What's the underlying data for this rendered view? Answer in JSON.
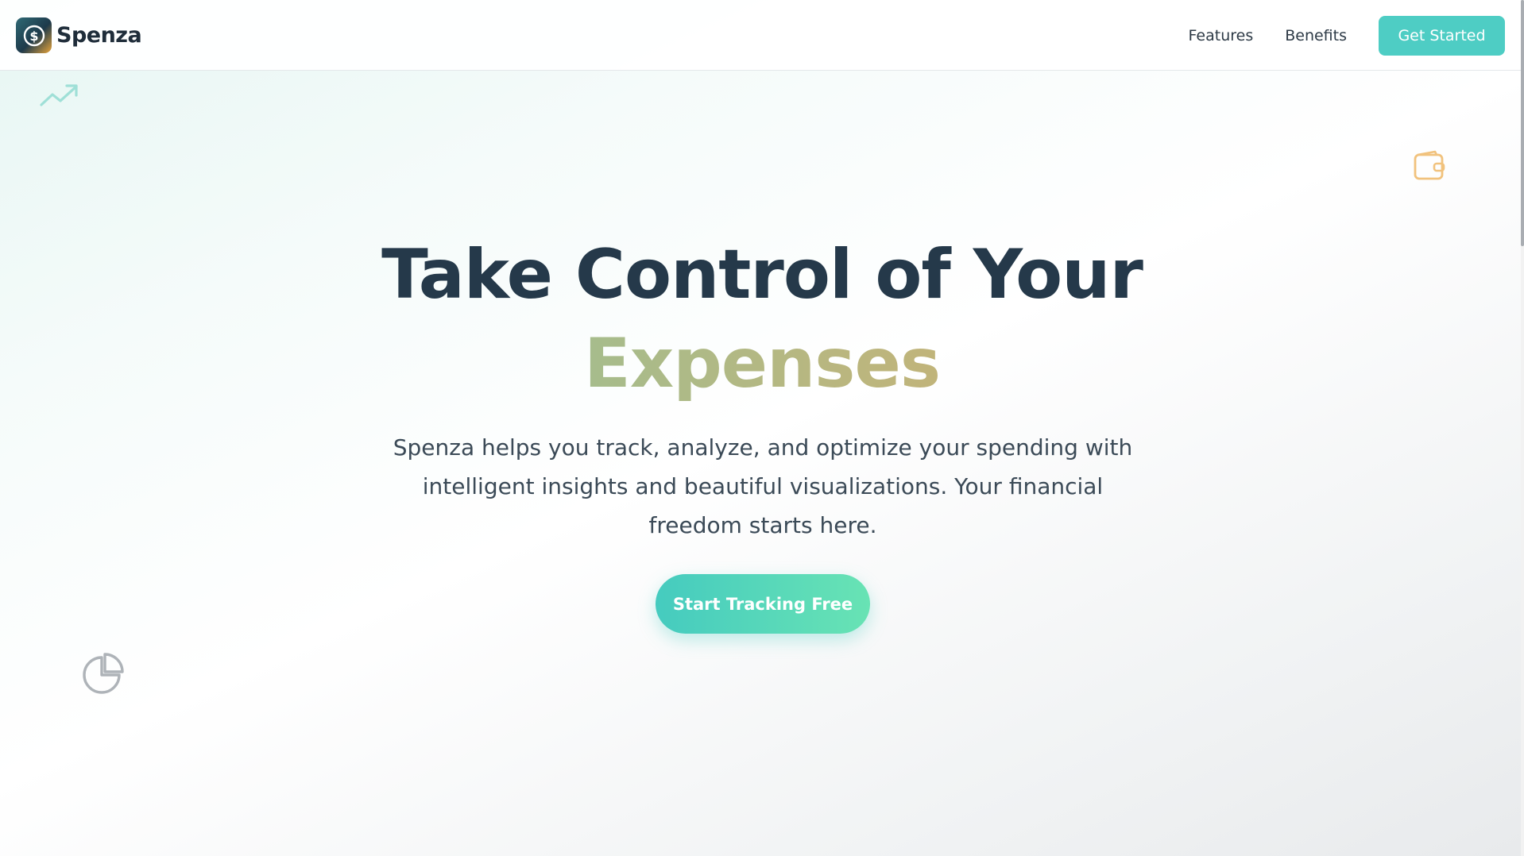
{
  "brand": {
    "name": "Spenza",
    "logo_icon": "dollar-coin-icon"
  },
  "nav": {
    "links": [
      "Features",
      "Benefits"
    ],
    "cta_label": "Get Started"
  },
  "hero": {
    "title_line1": "Take Control of Your",
    "title_accent": "Expenses",
    "subtitle": "Spenza helps you track, analyze, and optimize your spending with intelligent insights and beautiful visualizations. Your financial freedom starts here.",
    "cta_label": "Start Tracking Free"
  },
  "decorations": {
    "top_left_icon": "trending-up-icon",
    "top_right_icon": "wallet-icon",
    "bottom_left_icon": "pie-chart-icon"
  },
  "colors": {
    "accent": "#4ecdc4",
    "heading": "#25394a",
    "gradient_text_start": "#a6bc8c",
    "gradient_text_end": "#c1b47a",
    "wallet_icon": "#f1c27d"
  }
}
